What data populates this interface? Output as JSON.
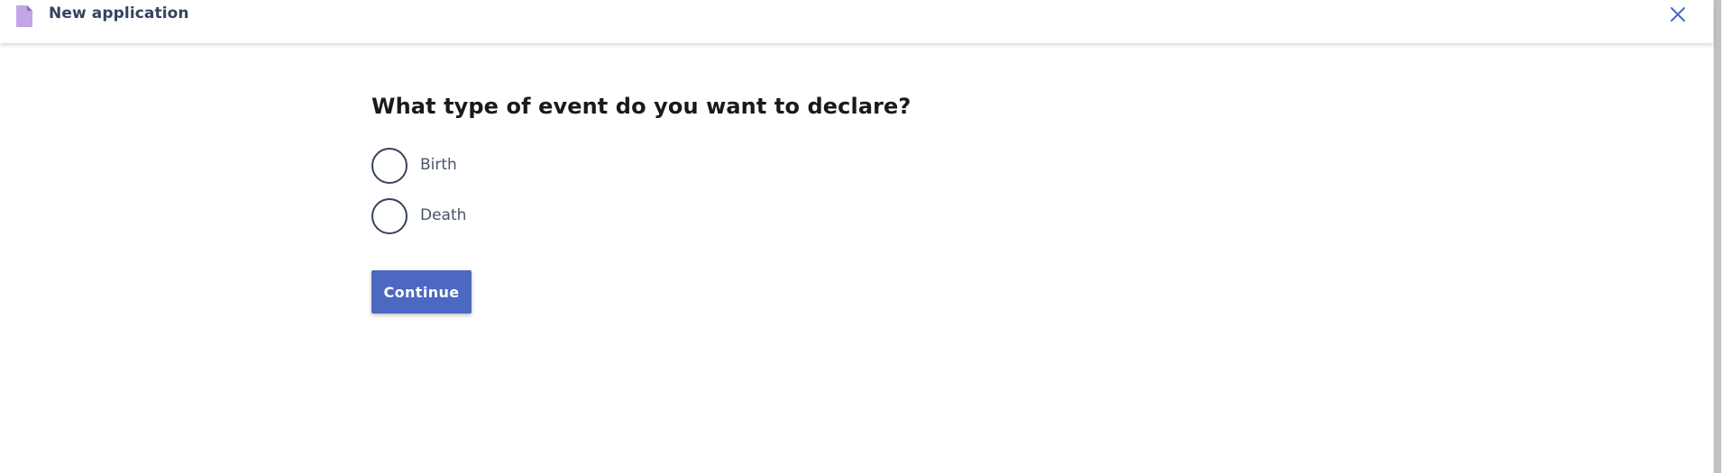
{
  "header": {
    "title": "New application",
    "icon": "document-icon",
    "icon_color": "#b79ad9",
    "close_icon": "close-icon"
  },
  "form": {
    "question": "What type of event do you want to declare?",
    "options": [
      {
        "label": "Birth",
        "selected": false
      },
      {
        "label": "Death",
        "selected": false
      }
    ],
    "continue_label": "Continue"
  },
  "colors": {
    "primary": "#4c68c1",
    "text_dark": "#35435d",
    "radio_border": "#35435d"
  }
}
